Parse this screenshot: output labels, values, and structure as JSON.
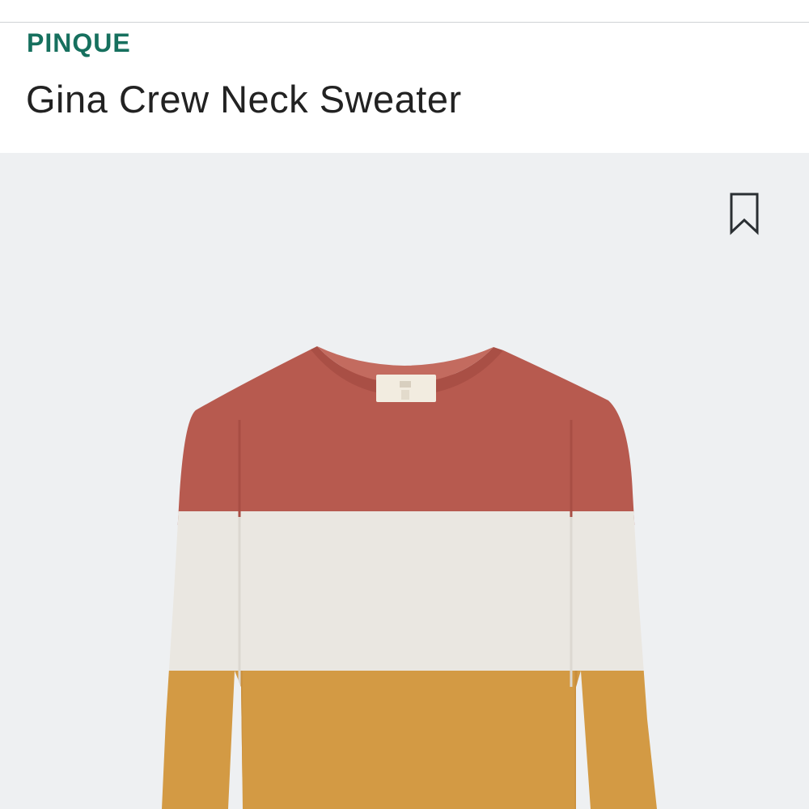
{
  "product": {
    "brand": "PINQUE",
    "title": "Gina Crew Neck Sweater"
  },
  "actions": {
    "save_icon": "bookmark-icon"
  },
  "colors": {
    "brand": "#16705e",
    "image_background": "#eef0f2",
    "stripe_top": "#b75a4f",
    "stripe_middle": "#eae7e1",
    "stripe_bottom": "#d39a44"
  }
}
